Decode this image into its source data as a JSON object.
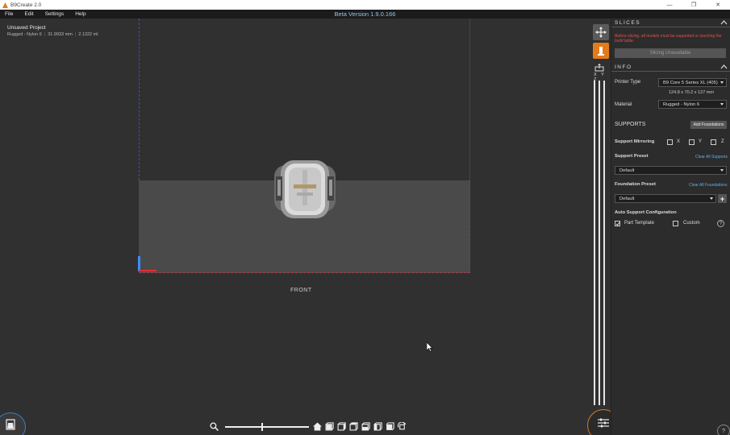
{
  "window": {
    "title": "B9Create 2.0",
    "controls": [
      "—",
      "❐",
      "✕"
    ]
  },
  "menu": [
    "File",
    "Edit",
    "Settings",
    "Help"
  ],
  "version": "Beta Version 1.9.0.166",
  "project": {
    "name": "Unsaved Project",
    "material": "Rugged - Nylon 6",
    "size": "31.9933 mm",
    "volume": "2.1322 ml"
  },
  "viewport": {
    "front_label": "FRONT"
  },
  "toolstrip": {
    "xyz": "X Y Z"
  },
  "panel": {
    "slices": {
      "title": "SLICES",
      "warning": "Before slicing, all models must be supported or touching the build table.",
      "button": "Slicing Unavailable"
    },
    "info": {
      "title": "INFO",
      "printer_label": "Printer Type",
      "printer_value": "B9 Core 5 Series XL (405)",
      "dims": "124.8 x 70.2 x 127 mm",
      "material_label": "Material",
      "material_value": "Rugged - Nylon 6"
    },
    "supports": {
      "title": "SUPPORTS",
      "add_foundations": "Add Foundations",
      "mirroring_label": "Support Mirroring",
      "x": "X",
      "y": "Y",
      "z": "Z",
      "preset_label": "Support Preset",
      "clear_supports": "Clear All Supports",
      "preset_value": "Default",
      "foundation_label": "Foundation Preset",
      "clear_foundations": "Clear All Foundations",
      "foundation_value": "Default",
      "auto_label": "Auto Support Configuration",
      "part_template": "Part Template",
      "custom": "Custom",
      "help": "?"
    }
  },
  "help_btn": "?",
  "colors": {
    "accent_orange": "#e57a1b",
    "link_blue": "#5ab0ea",
    "warning_red": "#e05050",
    "version_blue": "#8fc7e8"
  }
}
